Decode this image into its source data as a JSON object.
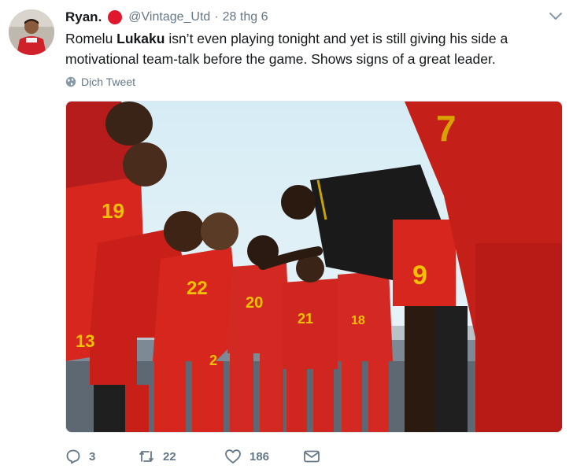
{
  "tweet": {
    "display_name": "Ryan.",
    "handle": "@Vintage_Utd",
    "separator": "·",
    "date": "28 thg 6",
    "text_before": "Romelu ",
    "text_bold": "Lukaku",
    "text_after": " isn’t even playing tonight and yet is still giving his side a motivational team-talk before the game. Shows signs of a great leader.",
    "translate_label": "Dịch Tweet"
  },
  "media": {
    "jersey_numbers": [
      "19",
      "22",
      "20",
      "21",
      "18",
      "9",
      "13",
      "7",
      "2"
    ]
  },
  "actions": {
    "reply_count": "3",
    "retweet_count": "22",
    "like_count": "186"
  },
  "icons": {
    "reply": "reply-icon",
    "retweet": "retweet-icon",
    "like": "heart-icon",
    "message": "envelope-icon",
    "translate": "globe-icon",
    "caret": "chevron-down-icon",
    "verified_dot": "red-dot-icon"
  },
  "colors": {
    "secondary_text": "#657786",
    "red_dot": "#e0182d",
    "jersey_red": "#d7261e"
  }
}
